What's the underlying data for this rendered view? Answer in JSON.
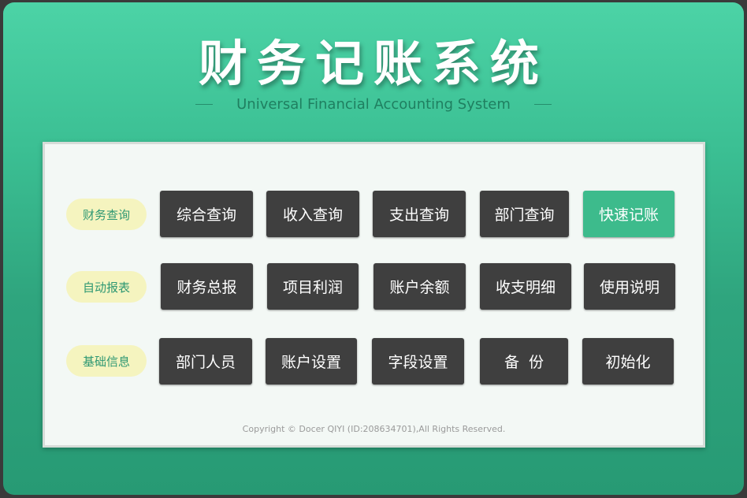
{
  "header": {
    "title": "财务记账系统",
    "subtitle": "Universal Financial Accounting System"
  },
  "rows": [
    {
      "label": "财务查询",
      "buttons": [
        "综合查询",
        "收入查询",
        "支出查询",
        "部门查询",
        "快速记账"
      ]
    },
    {
      "label": "自动报表",
      "buttons": [
        "财务总报",
        "项目利润",
        "账户余额",
        "收支明细",
        "使用说明"
      ]
    },
    {
      "label": "基础信息",
      "buttons": [
        "部门人员",
        "账户设置",
        "字段设置",
        "备  份",
        "初始化"
      ]
    }
  ],
  "footer": {
    "copyright": "Copyright © Docer QIYI (ID:208634701),All Rights Reserved."
  },
  "colors": {
    "accent": "#3dbb8c",
    "button": "#3f3f3f",
    "pill": "#f5f4bf",
    "frame_top": "#4cd3a6",
    "frame_bottom": "#279a74"
  }
}
